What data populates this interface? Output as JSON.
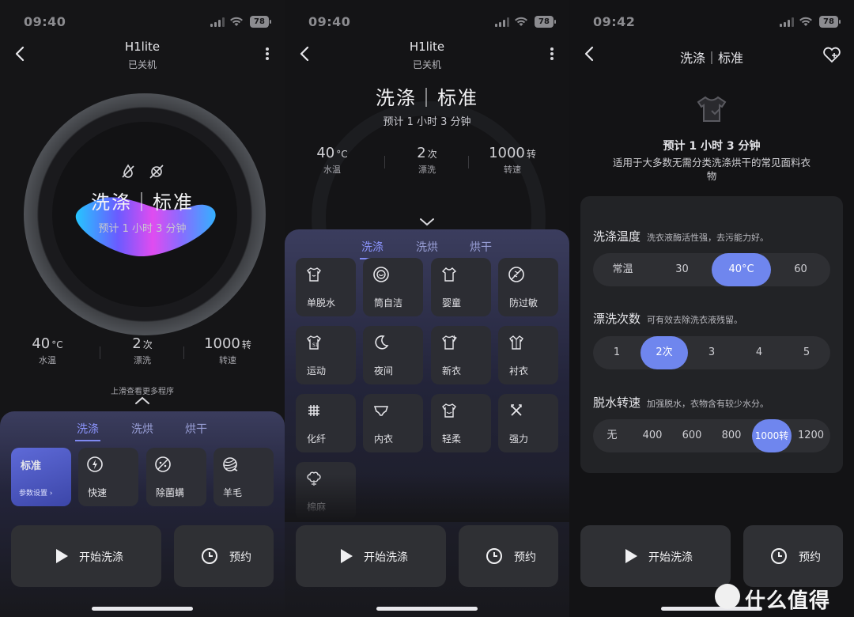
{
  "status_bar": [
    {
      "time": "09:40",
      "battery": "78"
    },
    {
      "time": "09:40",
      "battery": "78"
    },
    {
      "time": "09:42",
      "battery": "78"
    }
  ],
  "panel1": {
    "device_name": "H1lite",
    "device_status": "已关机",
    "mode": "洗涤｜标准",
    "eta": "预计 1 小时 3 分钟",
    "stats": [
      {
        "value": "40",
        "unit": "°C",
        "label": "水温"
      },
      {
        "value": "2",
        "unit": "次",
        "label": "漂洗"
      },
      {
        "value": "1000",
        "unit": "转",
        "label": "转速"
      }
    ],
    "swipe_hint": "上滑查看更多程序",
    "tabs": [
      "洗涤",
      "洗烘",
      "烘干"
    ],
    "active_tab": 0,
    "programs": [
      {
        "label": "标准",
        "sub": "参数设置 ›",
        "selected": true,
        "icon": "standard"
      },
      {
        "label": "快速",
        "icon": "bolt-icon"
      },
      {
        "label": "除菌螨",
        "icon": "sterilize-icon"
      },
      {
        "label": "羊毛",
        "icon": "wool-icon"
      }
    ]
  },
  "panel2": {
    "device_name": "H1lite",
    "device_status": "已关机",
    "mode": "洗涤｜标准",
    "eta": "预计 1 小时 3 分钟",
    "stats": [
      {
        "value": "40",
        "unit": "°C",
        "label": "水温"
      },
      {
        "value": "2",
        "unit": "次",
        "label": "漂洗"
      },
      {
        "value": "1000",
        "unit": "转",
        "label": "转速"
      }
    ],
    "tabs": [
      "洗涤",
      "洗烘",
      "烘干"
    ],
    "active_tab": 0,
    "programs": [
      {
        "label": "单脱水",
        "icon": "spin-icon"
      },
      {
        "label": "筒自洁",
        "icon": "drum-clean-icon"
      },
      {
        "label": "婴童",
        "icon": "baby-icon"
      },
      {
        "label": "防过敏",
        "icon": "anti-allergy-icon"
      },
      {
        "label": "运动",
        "icon": "sport-icon"
      },
      {
        "label": "夜间",
        "icon": "moon-icon"
      },
      {
        "label": "新衣",
        "icon": "new-clothes-icon"
      },
      {
        "label": "衬衣",
        "icon": "shirt-icon"
      },
      {
        "label": "化纤",
        "icon": "synthetic-icon"
      },
      {
        "label": "内衣",
        "icon": "underwear-icon"
      },
      {
        "label": "轻柔",
        "icon": "gentle-icon"
      },
      {
        "label": "强力",
        "icon": "heavy-icon"
      },
      {
        "label": "棉麻",
        "icon": "cotton-icon"
      }
    ]
  },
  "panel3": {
    "title": "洗涤｜标准",
    "eta": "预计 1 小时 3 分钟",
    "description": "适用于大多数无需分类洗涤烘干的常见面料衣物",
    "settings": [
      {
        "title": "洗涤温度",
        "hint": "洗衣液酶活性强，去污能力好。",
        "options": [
          "常温",
          "30",
          "40°C",
          "60"
        ],
        "selected": 2
      },
      {
        "title": "漂洗次数",
        "hint": "可有效去除洗衣液残留。",
        "options": [
          "1",
          "2次",
          "3",
          "4",
          "5"
        ],
        "selected": 1
      },
      {
        "title": "脱水转速",
        "hint": "加强脱水，衣物含有较少水分。",
        "options": [
          "无",
          "400",
          "600",
          "800",
          "1000转",
          "1200"
        ],
        "selected": 4
      }
    ]
  },
  "actions": {
    "start": "开始洗涤",
    "book": "预约"
  },
  "watermark": "什么值得买"
}
